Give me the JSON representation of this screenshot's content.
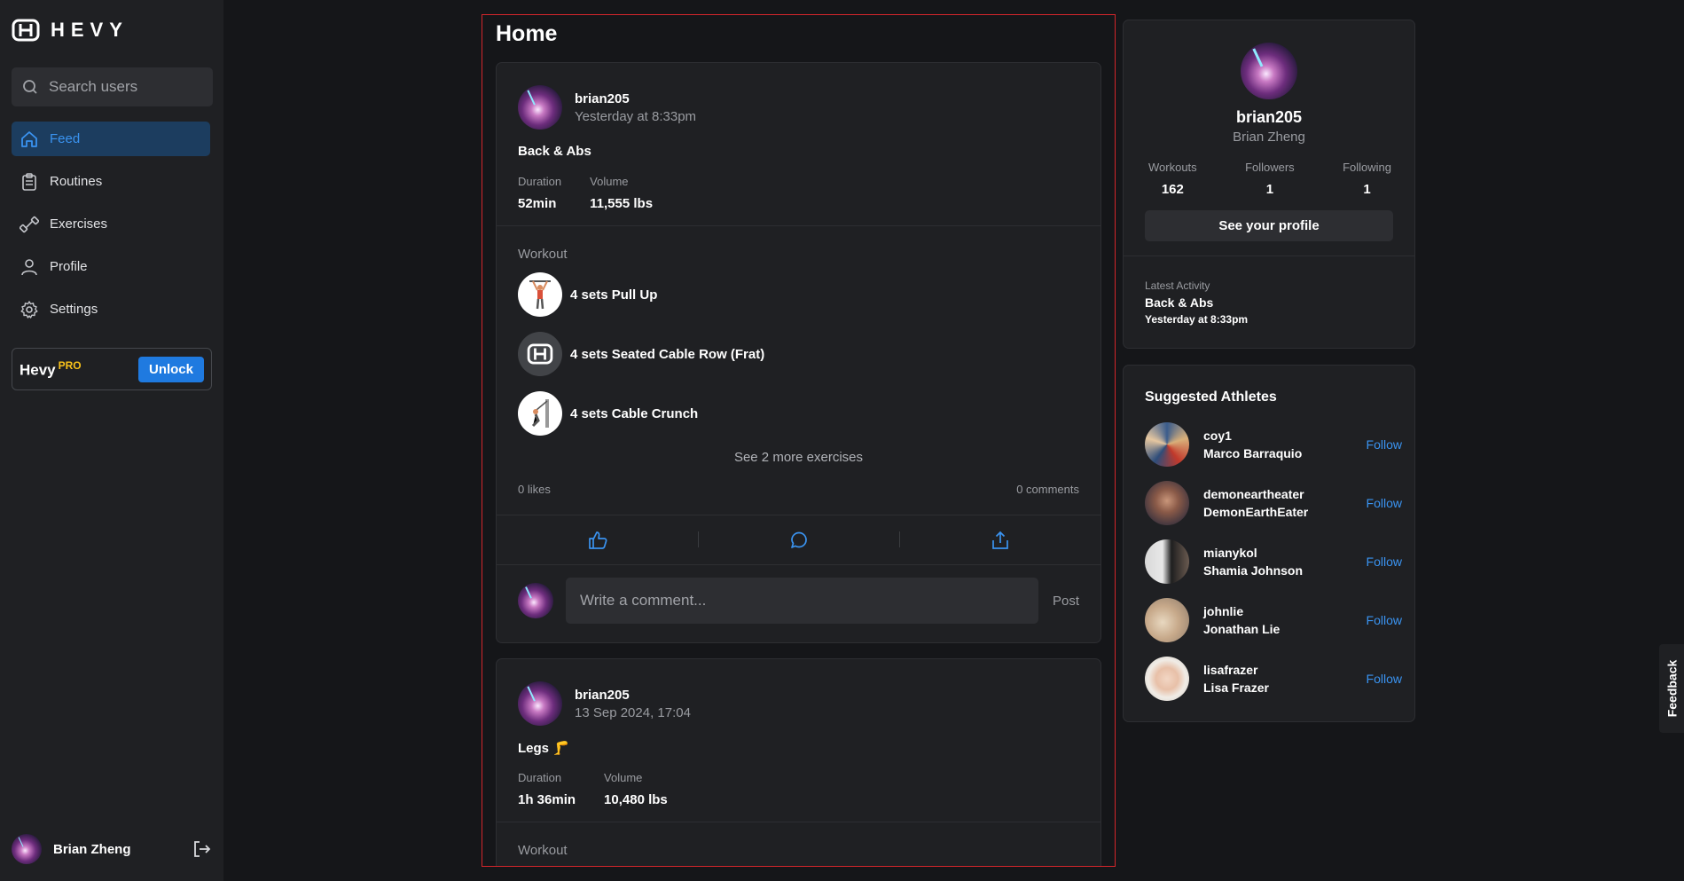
{
  "app": {
    "logo_text": "HEVY"
  },
  "sidebar": {
    "search_placeholder": "Search users",
    "nav": [
      {
        "label": "Feed",
        "icon": "home-icon",
        "active": true
      },
      {
        "label": "Routines",
        "icon": "clipboard-icon",
        "active": false
      },
      {
        "label": "Exercises",
        "icon": "dumbbell-icon",
        "active": false
      },
      {
        "label": "Profile",
        "icon": "user-icon",
        "active": false
      },
      {
        "label": "Settings",
        "icon": "gear-icon",
        "active": false
      }
    ],
    "pro": {
      "brand": "Hevy",
      "badge": "PRO",
      "button": "Unlock"
    },
    "current_user": "Brian Zheng"
  },
  "main": {
    "title": "Home",
    "posts": [
      {
        "username": "brian205",
        "time": "Yesterday at 8:33pm",
        "title": "Back & Abs",
        "duration_label": "Duration",
        "duration": "52min",
        "volume_label": "Volume",
        "volume": "11,555 lbs",
        "workout_label": "Workout",
        "exercises": [
          "4 sets Pull Up",
          "4 sets Seated Cable Row (Frat)",
          "4 sets Cable Crunch"
        ],
        "more": "See 2 more exercises",
        "likes": "0 likes",
        "comments": "0 comments",
        "comment_placeholder": "Write a comment...",
        "post_button": "Post"
      },
      {
        "username": "brian205",
        "time": "13 Sep 2024, 17:04",
        "title": "Legs 🦵",
        "duration_label": "Duration",
        "duration": "1h 36min",
        "volume_label": "Volume",
        "volume": "10,480 lbs",
        "workout_label": "Workout"
      }
    ]
  },
  "profile_card": {
    "username": "brian205",
    "full_name": "Brian Zheng",
    "stats": [
      {
        "label": "Workouts",
        "value": "162"
      },
      {
        "label": "Followers",
        "value": "1"
      },
      {
        "label": "Following",
        "value": "1"
      }
    ],
    "button": "See your profile",
    "latest_label": "Latest Activity",
    "latest_title": "Back & Abs",
    "latest_time": "Yesterday at 8:33pm"
  },
  "suggested": {
    "title": "Suggested Athletes",
    "follow_label": "Follow",
    "athletes": [
      {
        "username": "coy1",
        "name": "Marco Barraquio"
      },
      {
        "username": "demoneartheater",
        "name": "DemonEarthEater"
      },
      {
        "username": "mianykol",
        "name": "Shamia Johnson"
      },
      {
        "username": "johnlie",
        "name": "Jonathan Lie"
      },
      {
        "username": "lisafrazer",
        "name": "Lisa Frazer"
      }
    ]
  },
  "feedback_label": "Feedback",
  "colors": {
    "accent": "#3a93f0",
    "pro_badge": "#f8c21a",
    "unlock": "#1f7ae0",
    "frame": "#d3262b"
  }
}
